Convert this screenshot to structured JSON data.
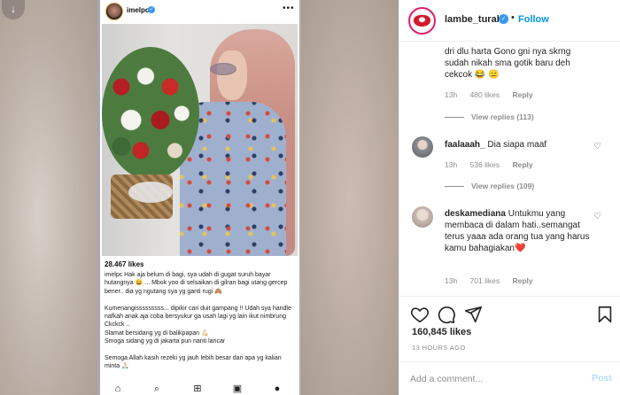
{
  "phone": {
    "username": "imelpc",
    "likes": "28.467 likes",
    "caption": "imelpc Hak aja belum di bagi, sya udah di gugat suruh bayar hutangnya 😄 ... Mbok yoo di selsaikan di gilran bagi utang gercep bener.. dia yg ngutang sya yg ganti rugi 🙈\n\nKumenangisssssssss... dipikir cari duit gampang !! Udah sya handle nafkah anak aja coba bersyukur ga usah lagi yg lain ikut nimbrung Ckckck ..\nSlamat bersidang yg di balikpapan 💪🏻\nSmoga sidang yg di jakarta pun nanti lancar\n\nSemoga Allah kasih rezeki yg jauh lebih besar dari apa yg kalian minta 🙏🏻"
  },
  "header": {
    "username": "lambe_turah",
    "separator": "•",
    "follow_label": "Follow"
  },
  "comments": [
    {
      "text": "dri dlu harta Gono gni nya skrng sudah nikah sma gotik baru deh cekcok 😂 😑",
      "time": "13h",
      "likes": "480 likes",
      "reply": "Reply",
      "view_replies": "View replies (113)"
    },
    {
      "user": "faalaaah_",
      "text": "Dia siapa maaf",
      "time": "13h",
      "likes": "536 likes",
      "reply": "Reply",
      "view_replies": "View replies (109)"
    },
    {
      "user": "deskamediana",
      "text": "Untukmu yang membaca di dalam hati..semangat terus yaaa ada orang tua yang harus kamu bahagiakan❤️",
      "time": "13h",
      "likes": "701 likes",
      "reply": "Reply"
    }
  ],
  "post": {
    "likes": "160,845 likes",
    "timestamp": "13 HOURS AGO"
  },
  "comment_box": {
    "placeholder": "Add a comment...",
    "post_label": "Post"
  },
  "icons": {
    "accent": "#0095f6",
    "heart": "heart-icon",
    "comment": "comment-icon",
    "share": "share-icon",
    "save": "bookmark-icon"
  }
}
